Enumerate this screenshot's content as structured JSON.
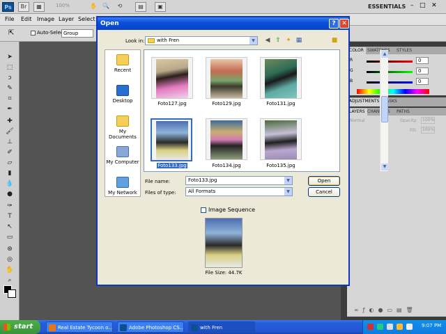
{
  "app": {
    "logo": "Ps",
    "logo_icon_bar": "Br",
    "zoom": "100%",
    "workspace": "ESSENTIALS",
    "menus": [
      "File",
      "Edit",
      "Image",
      "Layer",
      "Select"
    ],
    "options": {
      "auto_select_label": "Auto-Select:",
      "auto_select_value": "Group"
    }
  },
  "panels": {
    "color_tabs": [
      "COLOR",
      "SWATCHES",
      "STYLES"
    ],
    "rgb": [
      {
        "label": "R",
        "value": "0"
      },
      {
        "label": "G",
        "value": "0"
      },
      {
        "label": "B",
        "value": "0"
      }
    ],
    "adjust_tabs": [
      "ADJUSTMENTS",
      "MASKS"
    ],
    "layer_tabs": [
      "LAYERS",
      "CHANNELS",
      "PATHS"
    ],
    "blend_mode": "Normal",
    "opacity_label": "Opacity:",
    "opacity_value": "100%",
    "fill_label": "Fill:",
    "fill_value": "100%"
  },
  "dialog": {
    "title": "Open",
    "look_in_label": "Look in:",
    "look_in_value": "with Fren",
    "places": [
      "Recent",
      "Desktop",
      "My Documents",
      "My Computer",
      "My Network"
    ],
    "files": [
      {
        "name": "Foto127.jpg",
        "selected": false
      },
      {
        "name": "Foto129.jpg",
        "selected": false
      },
      {
        "name": "Foto131.jpg",
        "selected": false
      },
      {
        "name": "Foto133.jpg",
        "selected": true
      },
      {
        "name": "Foto134.jpg",
        "selected": false
      },
      {
        "name": "Foto135.jpg",
        "selected": false
      }
    ],
    "file_name_label": "File name:",
    "file_name_value": "Foto133.jpg",
    "file_type_label": "Files of type:",
    "file_type_value": "All Formats",
    "open_label": "Open",
    "cancel_label": "Cancel",
    "image_sequence_label": "Image Sequence",
    "file_size_text": "File Size: 44.7K"
  },
  "taskbar": {
    "start_label": "start",
    "tasks": [
      "Real Estate Tycoon o...",
      "Adobe Photoshop CS...",
      "with Fren"
    ],
    "clock": "9:07 PM"
  },
  "colors": {
    "xp_blue": "#0a50d8",
    "selection": "#316ac5",
    "ps_dark": "#535353"
  }
}
